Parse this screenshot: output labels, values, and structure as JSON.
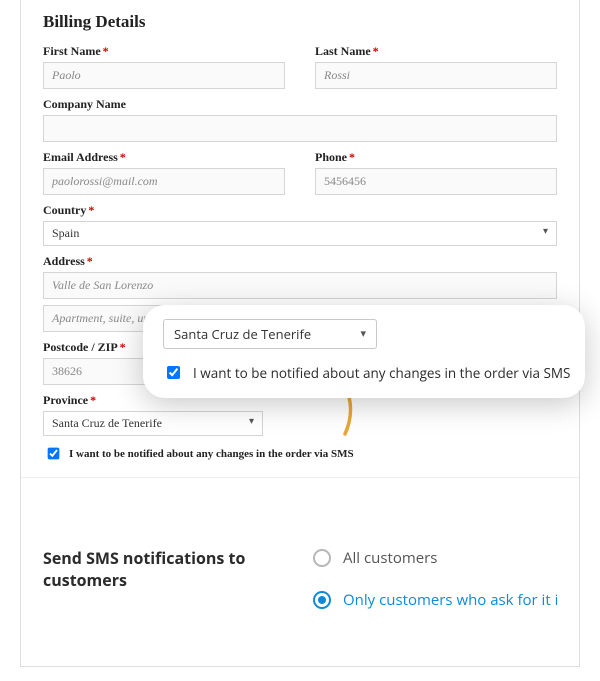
{
  "title": "Billing Details",
  "first_name": {
    "label": "First Name",
    "value": "Paolo"
  },
  "last_name": {
    "label": "Last Name",
    "value": "Rossi"
  },
  "company": {
    "label": "Company Name"
  },
  "email": {
    "label": "Email Address",
    "value": "paolorossi@mail.com"
  },
  "phone": {
    "label": "Phone",
    "value": "5456456"
  },
  "country": {
    "label": "Country",
    "value": "Spain"
  },
  "address": {
    "label": "Address",
    "line1": "Valle de San Lorenzo",
    "line2_placeholder": "Apartment, suite, unit etc. (optional)"
  },
  "postcode": {
    "label": "Postcode / ZIP",
    "value": "38626"
  },
  "province": {
    "label": "Province",
    "value": "Santa Cruz de Tenerife"
  },
  "sms_checkbox_label": "I want to be notified about any changes in the order via SMS",
  "callout": {
    "province_value": "Santa Cruz de Tenerife",
    "checkbox_label": "I want to be notified about any changes in the order via SMS"
  },
  "settings": {
    "heading": "Send SMS notifications to customers",
    "options": [
      {
        "label": "All customers",
        "selected": false
      },
      {
        "label": "Only customers who ask for it in ch",
        "selected": true
      }
    ]
  }
}
